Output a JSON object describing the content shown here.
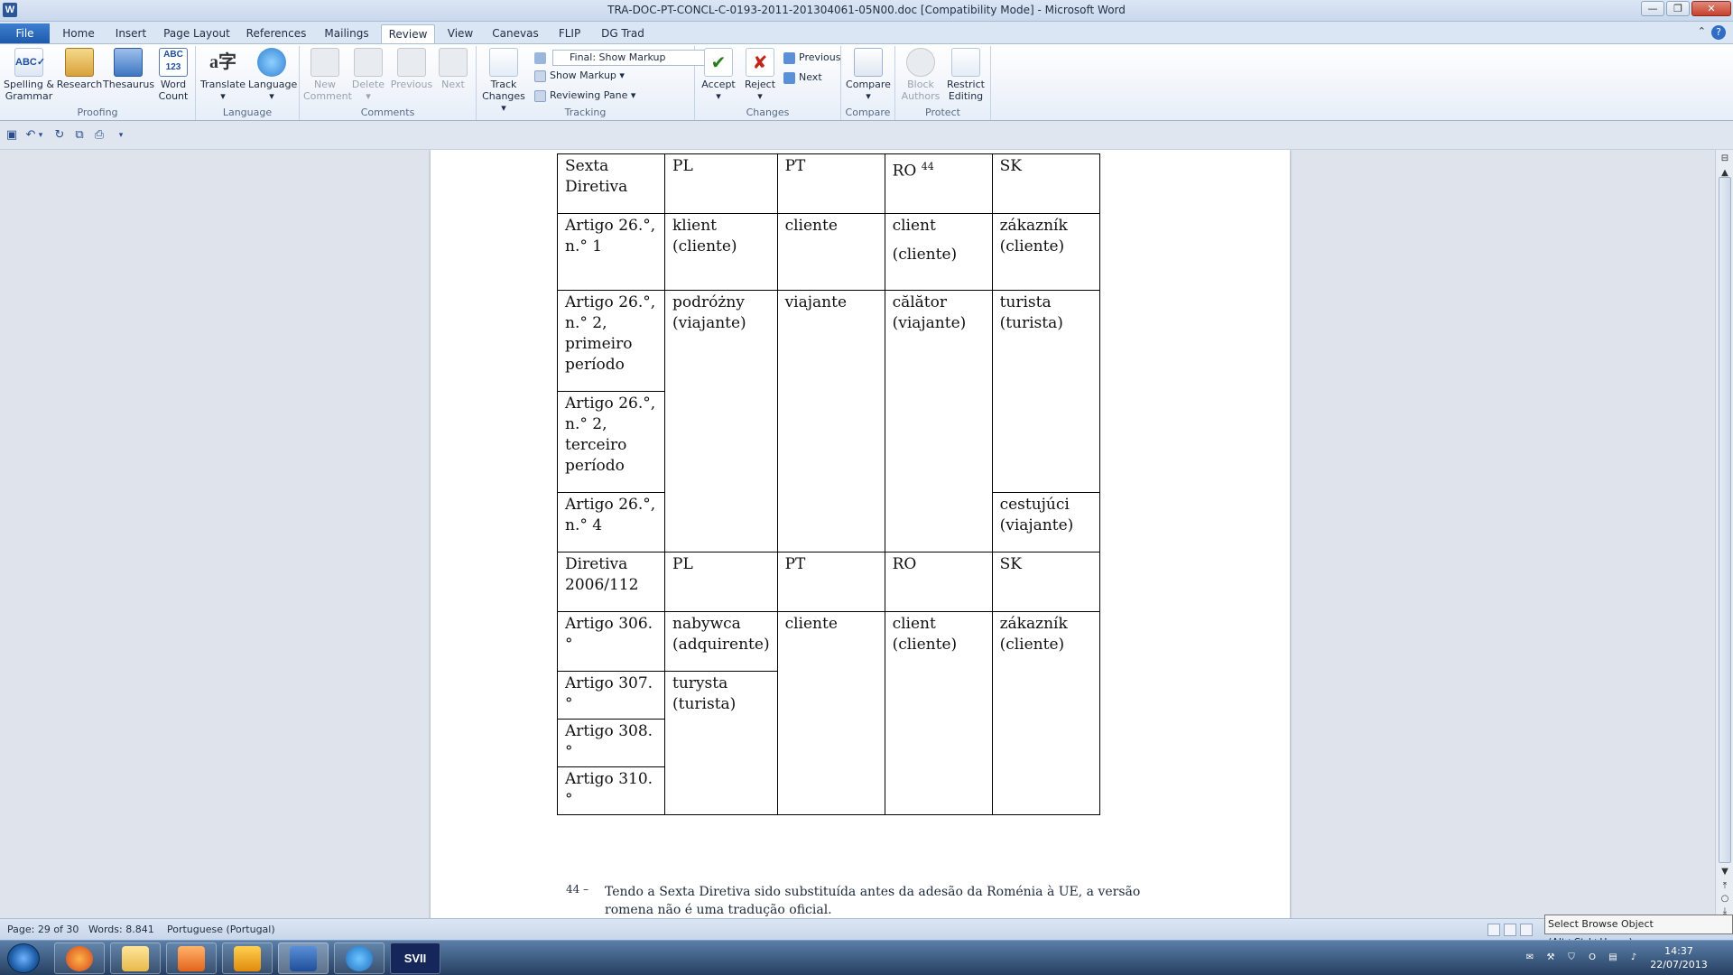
{
  "window": {
    "title": "TRA-DOC-PT-CONCL-C-0193-2011-201304061-05N00.doc [Compatibility Mode] - Microsoft Word",
    "app_icon": "W"
  },
  "tabs": [
    "File",
    "Home",
    "Insert",
    "Page Layout",
    "References",
    "Mailings",
    "Review",
    "View",
    "Canevas",
    "FLIP",
    "DG Trad"
  ],
  "active_tab": "Review",
  "ribbon": {
    "proofing": {
      "label": "Proofing",
      "spelling": "Spelling &",
      "spelling2": "Grammar",
      "research": "Research",
      "thesaurus": "Thesaurus",
      "word_count": "Word",
      "word_count2": "Count"
    },
    "language": {
      "label": "Language",
      "translate": "Translate",
      "language": "Language"
    },
    "comments": {
      "label": "Comments",
      "new": "New",
      "new2": "Comment",
      "delete": "Delete",
      "previous": "Previous",
      "next": "Next"
    },
    "tracking": {
      "label": "Tracking",
      "track": "Track",
      "track2": "Changes",
      "markup_select": "Final: Show Markup",
      "show_markup": "Show Markup",
      "reviewing_pane": "Reviewing Pane"
    },
    "changes": {
      "label": "Changes",
      "accept": "Accept",
      "reject": "Reject",
      "previous": "Previous",
      "next": "Next"
    },
    "compare": {
      "label": "Compare",
      "compare": "Compare"
    },
    "protect": {
      "label": "Protect",
      "block": "Block",
      "block2": "Authors",
      "restrict": "Restrict",
      "restrict2": "Editing"
    }
  },
  "document": {
    "table": {
      "r1": [
        "Sexta Diretiva",
        "PL",
        "PT",
        "RO",
        "SK"
      ],
      "r1_ro_footnote": "44",
      "r2": [
        "Artigo 26.°, n.° 1",
        "klient (cliente)",
        "cliente",
        "client",
        "(cliente)",
        "zákazník (cliente)"
      ],
      "r3": [
        "Artigo 26.°, n.° 2, primeiro período",
        "podróżny (viajante)",
        "viajante",
        "călător (viajante)",
        "turista (turista)"
      ],
      "r4": [
        "Artigo 26.°, n.° 2, terceiro período"
      ],
      "r5": [
        "Artigo 26.°, n.° 4",
        "cestujúci (viajante)"
      ],
      "r6": [
        "Diretiva 2006/112",
        "PL",
        "PT",
        "RO",
        "SK"
      ],
      "r7": [
        "Artigo 306.°",
        "nabywca (adquirente)",
        "cliente",
        "client (cliente)",
        "zákazník (cliente)"
      ],
      "r8": [
        "Artigo 307.°",
        "turysta (turista)"
      ],
      "r9": [
        "Artigo 308.°"
      ],
      "r10": [
        "Artigo 310.°"
      ]
    },
    "footnote": {
      "marker": "44 –",
      "text": "Tendo a Sexta Diretiva sido substituída antes da adesão da Roménia à UE, a versão romena não é uma tradução oficial."
    }
  },
  "statusbar": {
    "page": "Page: 29 of 30",
    "words": "Words: 8.841",
    "language": "Portuguese (Portugal)",
    "tooltip": "Select Browse Object (Alt+Ctrl+Home)"
  },
  "taskbar": {
    "clock_time": "14:37",
    "clock_date": "22/07/2013",
    "sv_label": "SVII"
  }
}
